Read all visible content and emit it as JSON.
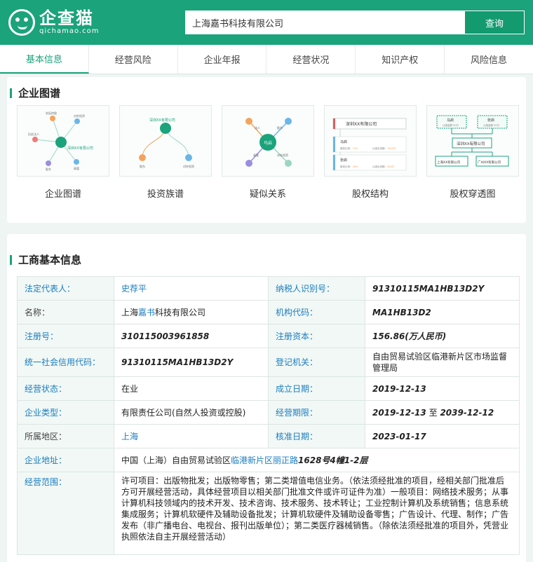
{
  "logo": {
    "cn": "企查猫",
    "en": "qichamao.com"
  },
  "search": {
    "value": "上海嘉书科技有限公司",
    "button": "查询"
  },
  "tabs": [
    "基本信息",
    "经营风险",
    "企业年报",
    "经营状况",
    "知识产权",
    "风险信息"
  ],
  "graph_panel": {
    "title": "企业图谱",
    "cards": [
      {
        "label": "企业图谱",
        "center": "深圳XX有限公司",
        "nodes": [
          "实际控股",
          "对外投资",
          "历史法人",
          "股东",
          "高管"
        ]
      },
      {
        "label": "投资族谱",
        "center": "深圳XX有限公司",
        "nodes": [
          "股东",
          "对外投资"
        ]
      },
      {
        "label": "疑似关系",
        "center": "马启",
        "nodes": [
          "法人",
          "股东",
          "高管",
          "对外投资"
        ]
      },
      {
        "label": "股权结构",
        "company": "深圳XX有限公司",
        "holders": [
          {
            "name": "马启",
            "ratio_label": "股权比例：",
            "ratio": "74%",
            "amount_label": "认缴出资额：",
            "amount": "1500万"
          },
          {
            "name": "张启",
            "ratio_label": "股权比例：",
            "ratio": "26%",
            "amount_label": "认缴出资额：",
            "amount": "500万"
          }
        ]
      },
      {
        "label": "股权穿透图",
        "top": [
          "马启",
          "张启"
        ],
        "top_sub": "认缴金额 50万",
        "center": "深圳XX有限公司",
        "bottom": [
          "上海XX有限公司",
          "广州XX有限公司"
        ]
      }
    ]
  },
  "business": {
    "title": "工商基本信息",
    "legal_rep_label": "法定代表人：",
    "legal_rep": "史荐平",
    "tax_id_label": "纳税人识别号：",
    "tax_id": "91310115MA1HB13D2Y",
    "name_label": "名称：",
    "name_prefix": "上海",
    "name_link": "嘉书",
    "name_suffix": "科技有限公司",
    "org_code_label": "机构代码：",
    "org_code": "MA1HB13D2",
    "reg_no_label": "注册号：",
    "reg_no": "310115003961858",
    "capital_label": "注册资本：",
    "capital": "156.86(万人民币)",
    "credit_code_label": "统一社会信用代码：",
    "credit_code": "91310115MA1HB13D2Y",
    "authority_label": "登记机关：",
    "authority": "自由贸易试验区临港新片区市场监督管理局",
    "status_label": "经营状态：",
    "status": "在业",
    "founded_label": "成立日期：",
    "founded": "2019-12-13",
    "type_label": "企业类型：",
    "type": "有限责任公司(自然人投资或控股)",
    "term_label": "经营期限：",
    "term_start": "2019-12-13",
    "term_to": "至",
    "term_end": "2039-12-12",
    "region_label": "所属地区：",
    "region": "上海",
    "approved_label": "核准日期：",
    "approved": "2023-01-17",
    "address_label": "企业地址：",
    "address_prefix": "中国（上海）自由贸易试验区",
    "address_link": "临港新片区丽正路",
    "address_suffix": "1628号4幢1-2层",
    "scope_label": "经营范围：",
    "scope": "许可项目：出版物批发；出版物零售；第二类增值电信业务。（依法须经批准的项目，经相关部门批准后方可开展经营活动，具体经营项目以相关部门批准文件或许可证件为准）一般项目：网络技术服务；从事计算机科技领域内的技术开发、技术咨询、技术服务、技术转让；工业控制计算机及系统销售；信息系统集成服务；计算机软硬件及辅助设备批发；计算机软硬件及辅助设备零售；广告设计、代理、制作；广告发布（非广播电台、电视台、报刊出版单位）；第二类医疗器械销售。（除依法须经批准的项目外，凭营业执照依法自主开展经营活动）"
  },
  "colors": {
    "brand": "#1ba37b",
    "link": "#1b7cc0",
    "label_bg": "#f1f8f5"
  }
}
